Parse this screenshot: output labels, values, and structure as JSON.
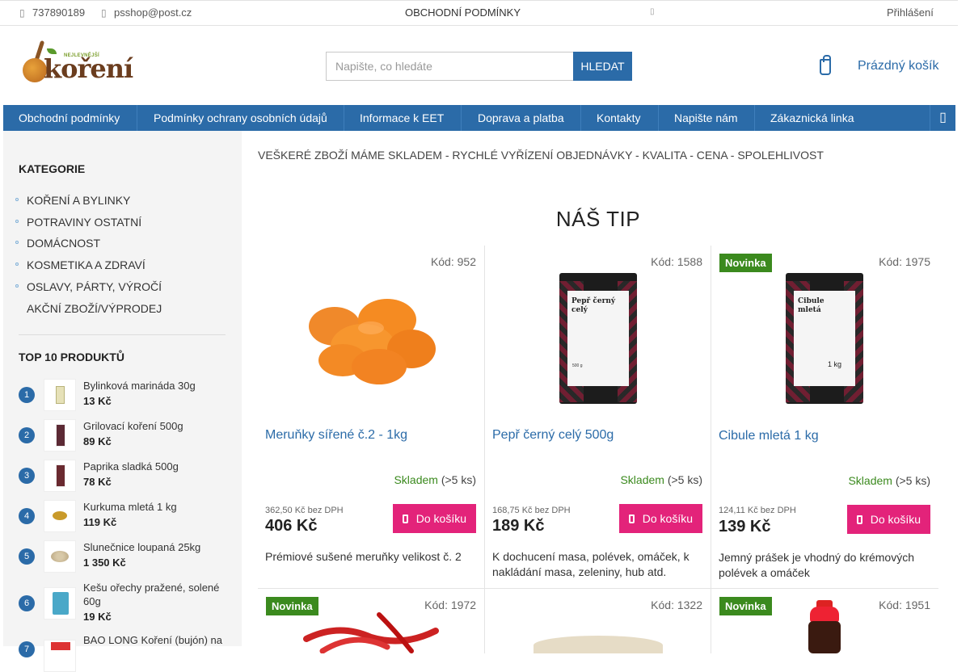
{
  "topbar": {
    "phone": "737890189",
    "email": "psshop@post.cz",
    "center_link": "OBCHODNÍ PODMÍNKY",
    "login": "Přihlášení"
  },
  "logo": {
    "small": "NEJLEVNĚJŠÍ",
    "word": "koření"
  },
  "search": {
    "placeholder": "Napište, co hledáte",
    "button": "HLEDAT"
  },
  "cart": {
    "label": "Prázdný košík"
  },
  "nav": {
    "items": [
      "Obchodní podmínky",
      "Podmínky ochrany osobních údajů",
      "Informace k EET",
      "Doprava a platba",
      "Kontakty",
      "Napište nám",
      "Zákaznická linka"
    ]
  },
  "sidebar": {
    "categories_title": "KATEGORIE",
    "categories": [
      "KOŘENÍ A BYLINKY",
      "POTRAVINY OSTATNÍ",
      "DOMÁCNOST",
      "KOSMETIKA A ZDRAVÍ",
      "OSLAVY, PÁRTY, VÝROČÍ",
      "AKČNÍ ZBOŽÍ/VÝPRODEJ"
    ],
    "top_title": "TOP 10 PRODUKTŮ",
    "top": [
      {
        "rank": "1",
        "name": "Bylinková marináda 30g",
        "price": "13 Kč"
      },
      {
        "rank": "2",
        "name": "Grilovací koření 500g",
        "price": "89 Kč"
      },
      {
        "rank": "3",
        "name": "Paprika sladká 500g",
        "price": "78 Kč"
      },
      {
        "rank": "4",
        "name": "Kurkuma mletá 1 kg",
        "price": "119 Kč"
      },
      {
        "rank": "5",
        "name": "Slunečnice loupaná 25kg",
        "price": "1 350 Kč"
      },
      {
        "rank": "6",
        "name": "Kešu ořechy pražené, solené 60g",
        "price": "19 Kč"
      },
      {
        "rank": "7",
        "name": "BAO LONG Koření (bujón) na",
        "price": ""
      }
    ]
  },
  "main": {
    "slogan": "VEŠKERÉ ZBOŽÍ MÁME SKLADEM - RYCHLÉ VYŘÍZENÍ OBJEDNÁVKY - KVALITA - CENA - SPOLEHLIVOST",
    "tip_title": "NÁŠ TIP",
    "products": [
      {
        "badge": "",
        "code": "Kód: 952",
        "name": "Meruňky sířené č.2 - 1kg",
        "stock_label": "Skladem",
        "stock_qty": "(>5 ks)",
        "price_no_vat": "362,50 Kč bez DPH",
        "price": "406 Kč",
        "buy": "Do košíku",
        "desc": "Prémiové sušené meruňky velikost č. 2"
      },
      {
        "badge": "",
        "code": "Kód: 1588",
        "name": "Pepř černý celý 500g",
        "stock_label": "Skladem",
        "stock_qty": "(>5 ks)",
        "price_no_vat": "168,75 Kč bez DPH",
        "price": "189 Kč",
        "buy": "Do košíku",
        "desc": "K dochucení masa, polévek, omáček, k nakládání masa, zeleniny, hub atd.",
        "pack_text": "Pepř černý celý",
        "pack_weight": "500 g"
      },
      {
        "badge": "Novinka",
        "code": "Kód: 1975",
        "name": "Cibule mletá 1 kg",
        "stock_label": "Skladem",
        "stock_qty": "(>5 ks)",
        "price_no_vat": "124,11 Kč bez DPH",
        "price": "139 Kč",
        "buy": "Do košíku",
        "desc": "Jemný prášek je vhodný do krémových polévek a omáček",
        "pack_text": "Cibule mletá",
        "pack_weight": "1 kg"
      }
    ],
    "row2": [
      {
        "badge": "Novinka",
        "code": "Kód: 1972"
      },
      {
        "badge": "",
        "code": "Kód: 1322"
      },
      {
        "badge": "Novinka",
        "code": "Kód: 1951"
      }
    ]
  },
  "colors": {
    "accent": "#2b6ba8",
    "buy": "#e3237a",
    "badge": "#3b8a1e"
  }
}
